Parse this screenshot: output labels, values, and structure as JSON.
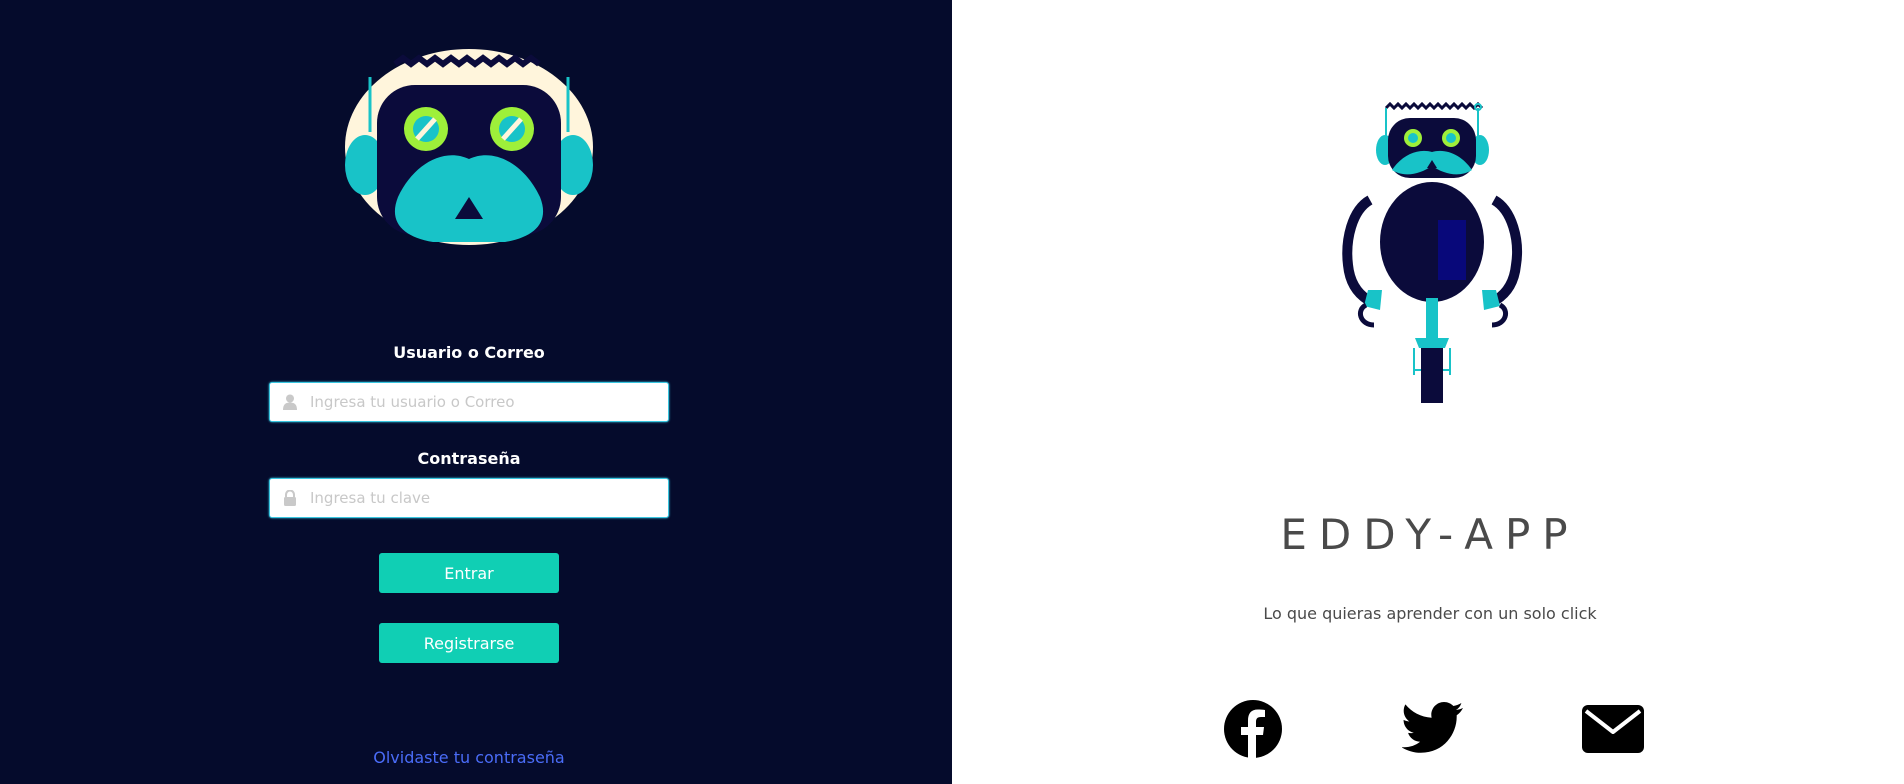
{
  "login": {
    "user_label": "Usuario o Correo",
    "user_placeholder": "Ingresa tu usuario o Correo",
    "user_value": "",
    "password_label": "Contraseña",
    "password_placeholder": "Ingresa tu clave",
    "password_value": "",
    "enter_button": "Entrar",
    "register_button": "Registrarse",
    "forgot_link": "Olvidaste tu contraseña"
  },
  "brand": {
    "title": "EDDY-APP",
    "tagline": "Lo que quieras aprender con un solo click"
  },
  "social": {
    "icons": [
      "facebook-icon",
      "twitter-icon",
      "mail-icon"
    ]
  },
  "colors": {
    "left_bg": "#050b2c",
    "accent": "#10cfb4",
    "link": "#4a6cf7",
    "input_border": "#39c6e0",
    "robot_dark": "#0b0b3b",
    "robot_teal": "#18c3c8",
    "robot_eye": "#9ef03a",
    "logo_bg": "#fff5dc"
  }
}
